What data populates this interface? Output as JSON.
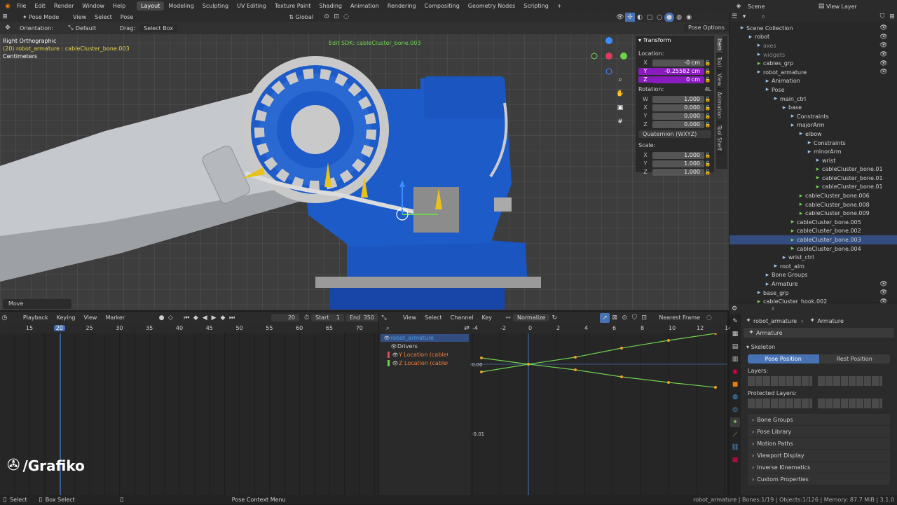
{
  "topbar": {
    "menus": [
      "File",
      "Edit",
      "Render",
      "Window",
      "Help"
    ],
    "workspaces": [
      "Layout",
      "Modeling",
      "Sculpting",
      "UV Editing",
      "Texture Paint",
      "Shading",
      "Animation",
      "Rendering",
      "Compositing",
      "Geometry Nodes",
      "Scripting"
    ],
    "active_workspace": "Layout",
    "add_tab": "+",
    "scene": "Scene",
    "view_layer": "View Layer"
  },
  "viewport_header": {
    "mode": "Pose Mode",
    "menus": [
      "View",
      "Select",
      "Pose"
    ],
    "transform_orientation": "Global",
    "pose_options": "Pose Options"
  },
  "tool_settings": {
    "orientation_label": "Orientation:",
    "orientation_value": "Default",
    "drag_label": "Drag:",
    "drag_value": "Select Box"
  },
  "viewport_overlay": {
    "view_name": "Right Orthographic",
    "active_info": "(20) robot_armature : cableCluster_bone.003",
    "units": "Centimeters",
    "edit_sdk": "Edit SDK: cableCluster_bone.003",
    "last_op": "Move"
  },
  "npanel": {
    "title": "Transform",
    "location_label": "Location:",
    "location": [
      {
        "axis": "X",
        "value": "-0 cm"
      },
      {
        "axis": "Y",
        "value": "-0.25582 cm"
      },
      {
        "axis": "Z",
        "value": "0 cm"
      }
    ],
    "rotation_label": "Rotation:",
    "rotation_mode_short": "4L",
    "rotation": [
      {
        "axis": "W",
        "value": "1.000"
      },
      {
        "axis": "X",
        "value": "0.000"
      },
      {
        "axis": "Y",
        "value": "0.000"
      },
      {
        "axis": "Z",
        "value": "0.000"
      }
    ],
    "rotation_mode": "Quaternion (WXYZ)",
    "scale_label": "Scale:",
    "scale": [
      {
        "axis": "X",
        "value": "1.000"
      },
      {
        "axis": "Y",
        "value": "1.000"
      },
      {
        "axis": "Z",
        "value": "1.000"
      }
    ],
    "tabs": [
      "Item",
      "Tool",
      "View",
      "Animation",
      "Tool Shelf"
    ]
  },
  "outliner": {
    "rows": [
      {
        "label": "Scene Collection",
        "indent": 0
      },
      {
        "label": "robot",
        "indent": 1
      },
      {
        "label": "axes",
        "indent": 2,
        "dim": true
      },
      {
        "label": "widgets",
        "indent": 2,
        "dim": true
      },
      {
        "label": "cables_grp",
        "indent": 2
      },
      {
        "label": "robot_armature",
        "indent": 2
      },
      {
        "label": "Animation",
        "indent": 3
      },
      {
        "label": "Pose",
        "indent": 3
      },
      {
        "label": "main_ctrl",
        "indent": 4
      },
      {
        "label": "base",
        "indent": 5
      },
      {
        "label": "Constraints",
        "indent": 6
      },
      {
        "label": "majorArm",
        "indent": 6
      },
      {
        "label": "elbow",
        "indent": 7
      },
      {
        "label": "Constraints",
        "indent": 8
      },
      {
        "label": "minorArm",
        "indent": 8
      },
      {
        "label": "wrist",
        "indent": 9
      },
      {
        "label": "cableCluster_bone.01",
        "indent": 9
      },
      {
        "label": "cableCluster_bone.01",
        "indent": 9
      },
      {
        "label": "cableCluster_bone.01",
        "indent": 9
      },
      {
        "label": "cableCluster_bone.006",
        "indent": 7
      },
      {
        "label": "cableCluster_bone.008",
        "indent": 7
      },
      {
        "label": "cableCluster_bone.009",
        "indent": 7
      },
      {
        "label": "cableCluster_bone.005",
        "indent": 6
      },
      {
        "label": "cableCluster_bone.002",
        "indent": 6
      },
      {
        "label": "cableCluster_bone.003",
        "indent": 6,
        "selected": true
      },
      {
        "label": "cableCluster_bone.004",
        "indent": 6
      },
      {
        "label": "wrist_ctrl",
        "indent": 5
      },
      {
        "label": "root_aim",
        "indent": 4
      },
      {
        "label": "Bone Groups",
        "indent": 3
      },
      {
        "label": "Armature",
        "indent": 3
      },
      {
        "label": "base_grp",
        "indent": 2
      },
      {
        "label": "cableCluster_hook.002",
        "indent": 2
      }
    ]
  },
  "timeline": {
    "menus": [
      "Playback",
      "Keying",
      "View",
      "Marker"
    ],
    "current_frame": "20",
    "start_label": "Start",
    "start": "1",
    "end_label": "End",
    "end": "350",
    "ruler": [
      "15",
      "20",
      "25",
      "30",
      "35",
      "40",
      "45",
      "50",
      "55",
      "60",
      "65",
      "70"
    ]
  },
  "graph": {
    "menus": [
      "View",
      "Select",
      "Channel",
      "Key"
    ],
    "normalize": "Normalize",
    "snap": "Nearest Frame",
    "ruler": [
      "-4",
      "-2",
      "0",
      "2",
      "4",
      "6",
      "8",
      "10",
      "12",
      "14"
    ],
    "y_labels": [
      "0.00",
      "-0.01"
    ],
    "channels": [
      {
        "label": "robot_armature",
        "color": "#4da0e8"
      },
      {
        "label": "Drivers",
        "color": "#cccccc"
      },
      {
        "label": "Y Location (cableClu",
        "color": "#e87d3e"
      },
      {
        "label": "Z Location (cableClu",
        "color": "#e87d3e"
      }
    ]
  },
  "properties": {
    "breadcrumb_obj": "robot_armature",
    "breadcrumb_data": "Armature",
    "name": "Armature",
    "skeleton": "Skeleton",
    "pose_position": "Pose Position",
    "rest_position": "Rest Position",
    "layers_label": "Layers:",
    "protected_label": "Protected Layers:",
    "panels": [
      "Bone Groups",
      "Pose Library",
      "Motion Paths",
      "Viewport Display",
      "Inverse Kinematics",
      "Custom Properties"
    ]
  },
  "statusbar": {
    "select": "Select",
    "box_select": "Box Select",
    "context_menu": "Pose Context Menu",
    "stats": "robot_armature | Bones:1/19 | Objects:1/126 | Memory: 87.7 MiB | 3.1.0"
  },
  "watermark": "/Grafiko",
  "colors": {
    "accent": "#4772b3",
    "selection": "#334d80",
    "purple": "#8a1bbf",
    "robot_blue": "#1a5fc0"
  }
}
